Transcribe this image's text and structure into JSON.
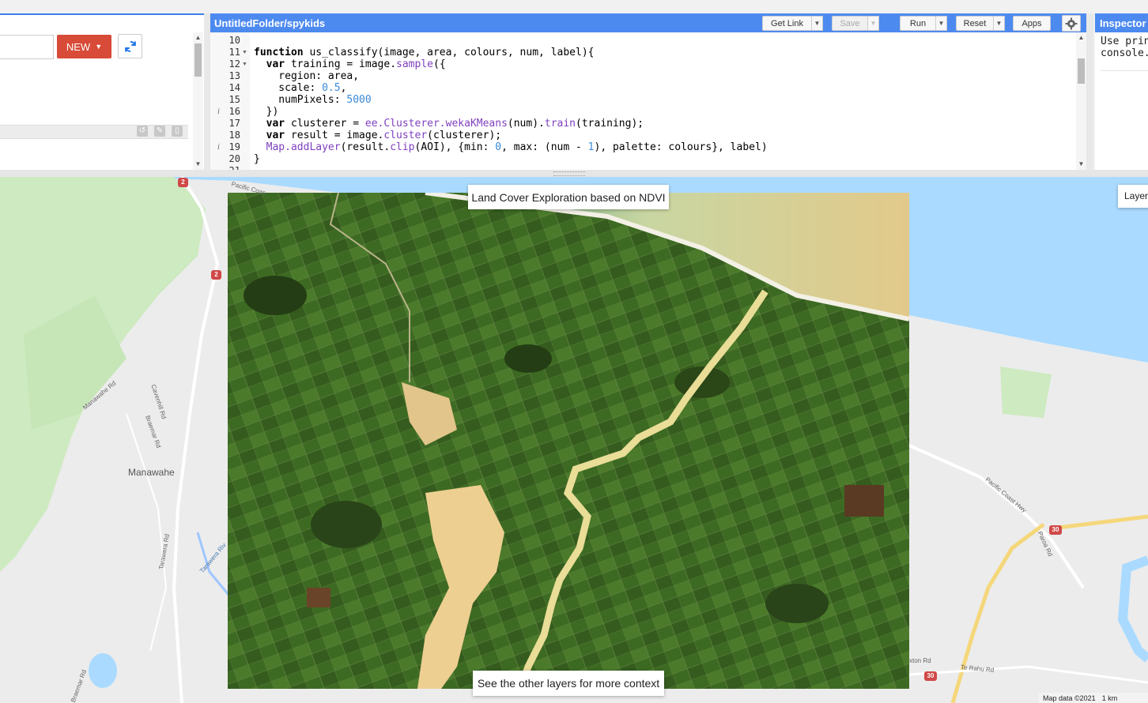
{
  "left_panel": {
    "new_button_label": "NEW",
    "search_value": ""
  },
  "editor": {
    "title": "UntitledFolder/spykids",
    "toolbar": {
      "get_link": "Get Link",
      "save": "Save",
      "run": "Run",
      "reset": "Reset",
      "apps": "Apps"
    },
    "lines": [
      {
        "n": "10",
        "text": ""
      },
      {
        "n": "11",
        "text": "function us_classify(image, area, colours, num, label){"
      },
      {
        "n": "12",
        "text": "  var training = image.sample({"
      },
      {
        "n": "13",
        "text": "    region: area,"
      },
      {
        "n": "14",
        "text": "    scale: 0.5,"
      },
      {
        "n": "15",
        "text": "    numPixels: 5000"
      },
      {
        "n": "16",
        "text": "  })"
      },
      {
        "n": "17",
        "text": "  var clusterer = ee.Clusterer.wekaKMeans(num).train(training);"
      },
      {
        "n": "18",
        "text": "  var result = image.cluster(clusterer);"
      },
      {
        "n": "19",
        "text": "  Map.addLayer(result.clip(AOI), {min: 0, max: (num - 1), palette: colours}, label)"
      },
      {
        "n": "20",
        "text": "}"
      },
      {
        "n": "21",
        "text": ""
      }
    ]
  },
  "inspector": {
    "title": "Inspector",
    "body_text": "Use prin\nconsole."
  },
  "map": {
    "title_box": "Land Cover Exploration based on NDVI",
    "bottom_box": "See the other layers for more context",
    "layers_button": "Layers",
    "place_labels": {
      "manawahe": "Manawahe",
      "manawahe_rd": "Manawahe Rd",
      "cavenhill_rd": "Cavenhill Rd",
      "braemar_rd": "Braemar Rd",
      "braemar_rd2": "Braemar Rd",
      "tarawera_rd": "Tarawera Rd",
      "tarawera_river": "Tarawera Riv",
      "pacific_coast_hwy": "Pacific Coast Hwy",
      "pacific_coast_top": "Pacific Coas",
      "paroa_rd": "Paroa Rd",
      "te_rahu_rd": "Te Rahu Rd",
      "thornton_rd": "xton Rd"
    },
    "shields": {
      "s2a": "2",
      "s2b": "2",
      "s30a": "30",
      "s30b": "30"
    },
    "attribution": {
      "data": "Map data ©2021",
      "scale": "1 km"
    }
  },
  "colors": {
    "header_blue": "#4d8af0",
    "new_button_red": "#d84b38",
    "keyword_purple": "#7f3fbf",
    "number_blue": "#3a8ad8",
    "sea_blue": "#aadaff",
    "land_green": "#cdeac0"
  }
}
